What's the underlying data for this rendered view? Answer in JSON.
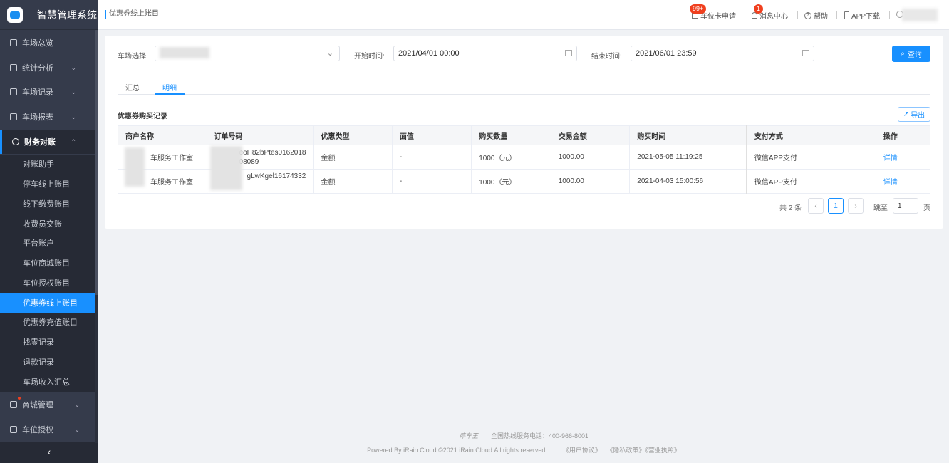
{
  "app": {
    "title": "智慧管理系统"
  },
  "sidebar": {
    "items": [
      {
        "label": "车场总览"
      },
      {
        "label": "统计分析"
      },
      {
        "label": "车场记录"
      },
      {
        "label": "车场报表"
      },
      {
        "label": "财务对账"
      }
    ],
    "sub_items": [
      "对账助手",
      "停车线上账目",
      "线下缴费账目",
      "收费员交账",
      "平台账户",
      "车位商城账目",
      "车位授权账目",
      "优惠券线上账目",
      "优惠券充值账目",
      "找零记录",
      "退款记录",
      "车场收入汇总"
    ],
    "bottom_items": [
      {
        "label": "商城管理"
      },
      {
        "label": "车位授权"
      }
    ],
    "collapse": "‹"
  },
  "header": {
    "breadcrumb": "优惠券线上账目",
    "card_apply": "车位卡申请",
    "card_badge": "99+",
    "messages": "消息中心",
    "msg_badge": "1",
    "help": "帮助",
    "app_download": "APP下载"
  },
  "filters": {
    "lot_label": "车场选择",
    "start_label": "开始时间:",
    "start_value": "2021/04/01 00:00",
    "end_label": "结束时间:",
    "end_value": "2021/06/01 23:59",
    "query": "查询"
  },
  "tabs": [
    "汇总",
    "明细"
  ],
  "section": {
    "title": "优惠券购买记录",
    "export": "导出"
  },
  "table": {
    "headers": [
      "商户名称",
      "订单号码",
      "优惠类型",
      "面值",
      "购买数量",
      "交易金额",
      "购买时间",
      "支付方式",
      "操作"
    ],
    "rows": [
      [
        "车服务工作室",
        "eoH82bPtes0162018",
        "金额",
        "-",
        "1000（元）",
        "1000.00",
        "2021-05-05 11:19:25",
        "微信APP支付",
        "详情"
      ],
      [
        "车服务工作室",
        "gLwKgel16174332",
        "金额",
        "-",
        "1000（元）",
        "1000.00",
        "2021-04-03 15:00:56",
        "微信APP支付",
        "详情"
      ]
    ],
    "row1_order_line2": "08089"
  },
  "pagination": {
    "total": "共 2 条",
    "prev": "‹",
    "page": "1",
    "next": "›",
    "goto": "跳至",
    "goto_value": "1",
    "page_unit": "页"
  },
  "footer": {
    "brand": "停车王",
    "hotline": "全国热线服务电话：400-966-8001",
    "copyright": "Powered By iRain Cloud ©2021 iRain Cloud.All rights reserved.",
    "links": [
      "《用户协议》",
      "《隐私政策》",
      "《营业执照》"
    ]
  }
}
